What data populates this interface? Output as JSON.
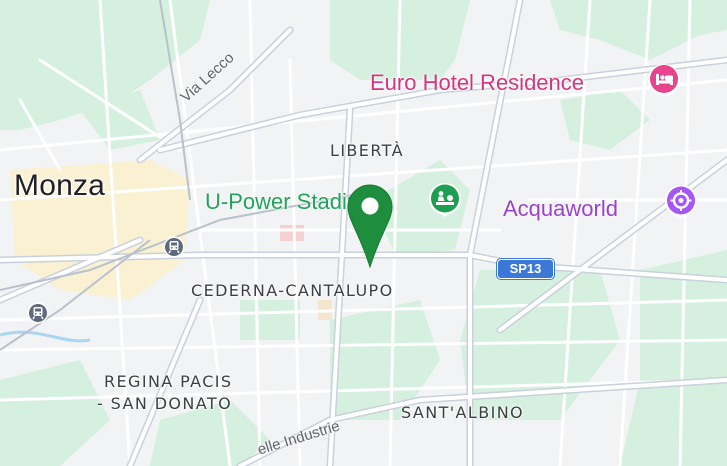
{
  "map": {
    "colors": {
      "land": "#f2f3f4",
      "park": "#cfeedb",
      "urban": "#fbefc8",
      "road": "#ffffff",
      "arterial": "#c9d1dc",
      "highway_shield": "#3b78d8",
      "pin": "#1e8e3e"
    },
    "labels": {
      "city": "Monza",
      "neighborhoods": {
        "liberta": "LIBERTÀ",
        "cederna": "CEDERNA-CANTALUPO",
        "regina_line1": "REGINA PACIS",
        "regina_line2": "- SAN DONATO",
        "santalbino": "SANT'ALBINO"
      },
      "streets": {
        "via_lecco": "Via Lecco",
        "delle_industrie": "elle Industrie"
      },
      "highway": "SP13"
    },
    "pois": [
      {
        "name": "Euro Hotel Residence",
        "icon": "hotel-bed-icon",
        "color": "#e8448d"
      },
      {
        "name": "U-Power Stadium",
        "icon": "stadium-icon",
        "color": "#1e9e50"
      },
      {
        "name": "Acquaworld",
        "icon": "water-park-icon",
        "color": "#a855f7"
      }
    ],
    "transit_icons": [
      "train-station-icon",
      "train-station-icon"
    ],
    "marker": {
      "icon": "location-pin-icon"
    }
  }
}
